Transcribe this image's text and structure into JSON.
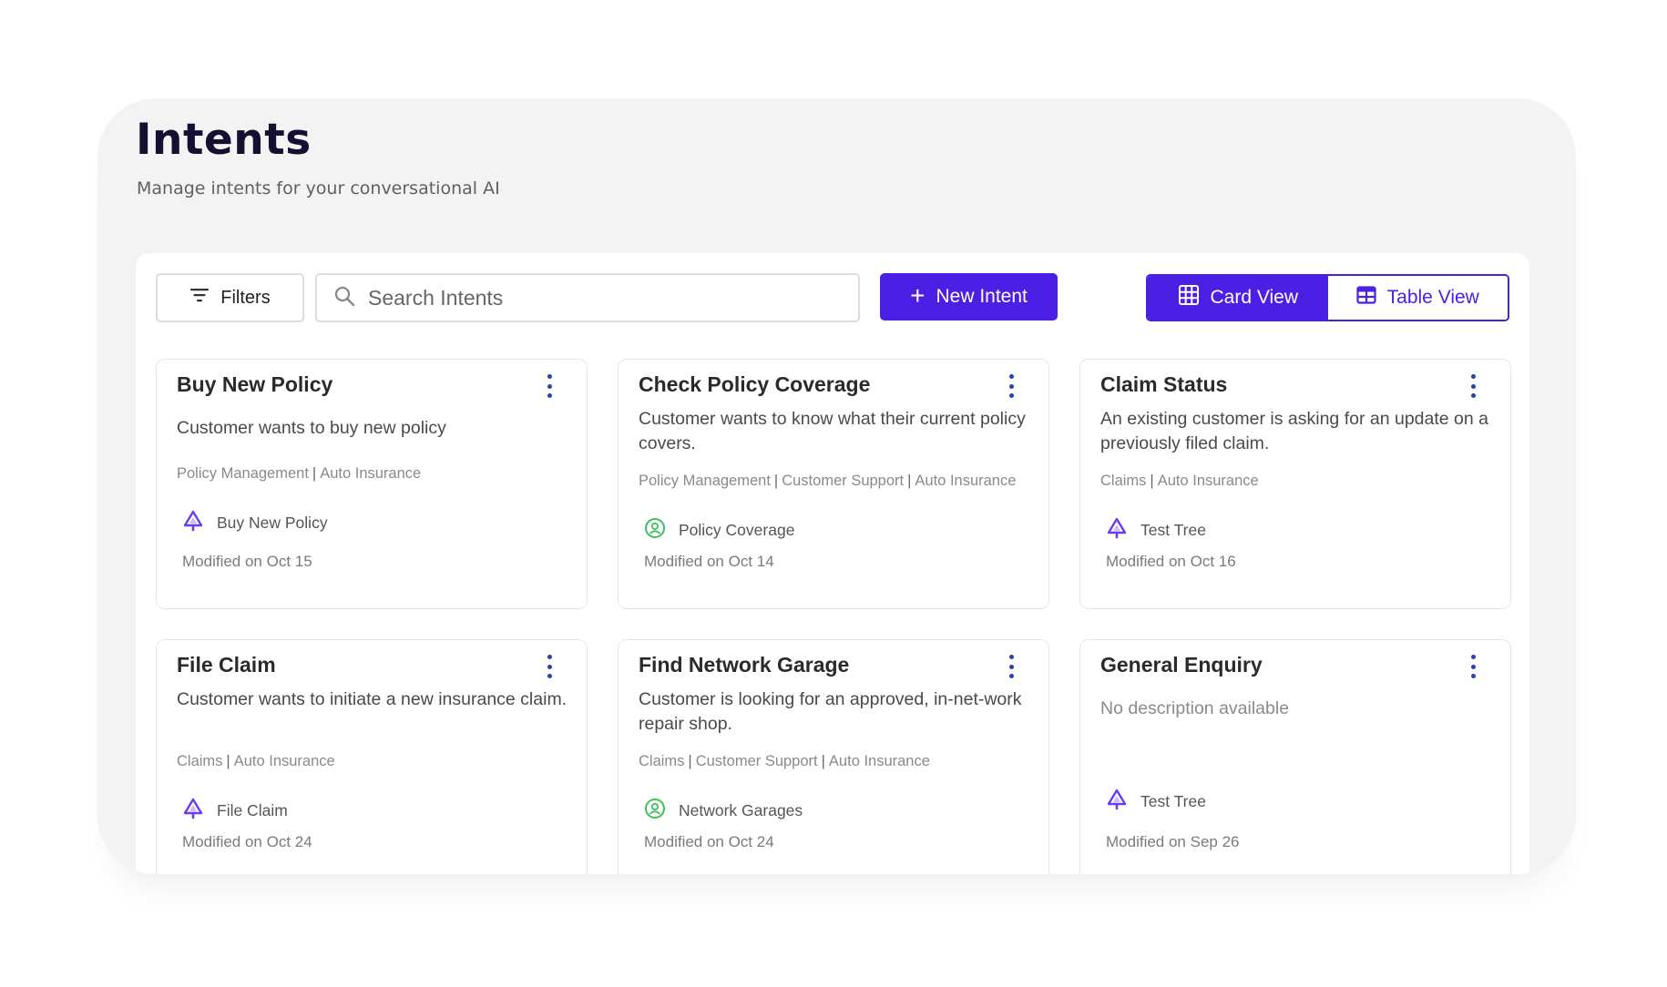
{
  "header": {
    "title": "Intents",
    "subtitle": "Manage intents for your conversational AI"
  },
  "toolbar": {
    "filters_label": "Filters",
    "search_placeholder": "Search Intents",
    "search_value": "",
    "new_intent_label": "New Intent",
    "card_view_label": "Card View",
    "table_view_label": "Table View",
    "active_view": "card"
  },
  "colors": {
    "accent": "#4b1fe4",
    "tree_icon": "#6a3cf0",
    "coverage_icon": "#3fbf5a"
  },
  "cards": [
    {
      "title": "Buy New Policy",
      "description": "Customer wants to buy new policy",
      "tags": [
        "Policy Management",
        "Auto Insurance"
      ],
      "flow_icon": "tree-icon",
      "flow_name": "Buy New Policy",
      "modified": "Modified on Oct 15"
    },
    {
      "title": "Check Policy Coverage",
      "description": "Customer wants to know what their current policy covers.",
      "tags": [
        "Policy Management",
        "Customer Support",
        "Auto Insurance"
      ],
      "flow_icon": "support-agent-icon",
      "flow_name": "Policy Coverage",
      "modified": "Modified on Oct 14"
    },
    {
      "title": "Claim Status",
      "description": "An existing customer is asking for an update on a previously filed claim.",
      "tags": [
        "Claims",
        "Auto Insurance"
      ],
      "flow_icon": "tree-icon",
      "flow_name": "Test Tree",
      "modified": "Modified on Oct 16"
    },
    {
      "title": "File Claim",
      "description": "Customer wants to initiate a new insurance claim.",
      "tags": [
        "Claims",
        "Auto Insurance"
      ],
      "flow_icon": "tree-icon",
      "flow_name": "File Claim",
      "modified": "Modified on Oct 24"
    },
    {
      "title": "Find Network Garage",
      "description": "Customer is looking for an approved, in-net-work repair shop.",
      "tags": [
        "Claims",
        "Customer Support",
        "Auto Insurance"
      ],
      "flow_icon": "support-agent-icon",
      "flow_name": "Network Garages",
      "modified": "Modified on Oct 24"
    },
    {
      "title": "General Enquiry",
      "description": "No description available",
      "tags": [],
      "flow_icon": "tree-icon",
      "flow_name": "Test Tree",
      "modified": "Modified on Sep 26"
    }
  ]
}
